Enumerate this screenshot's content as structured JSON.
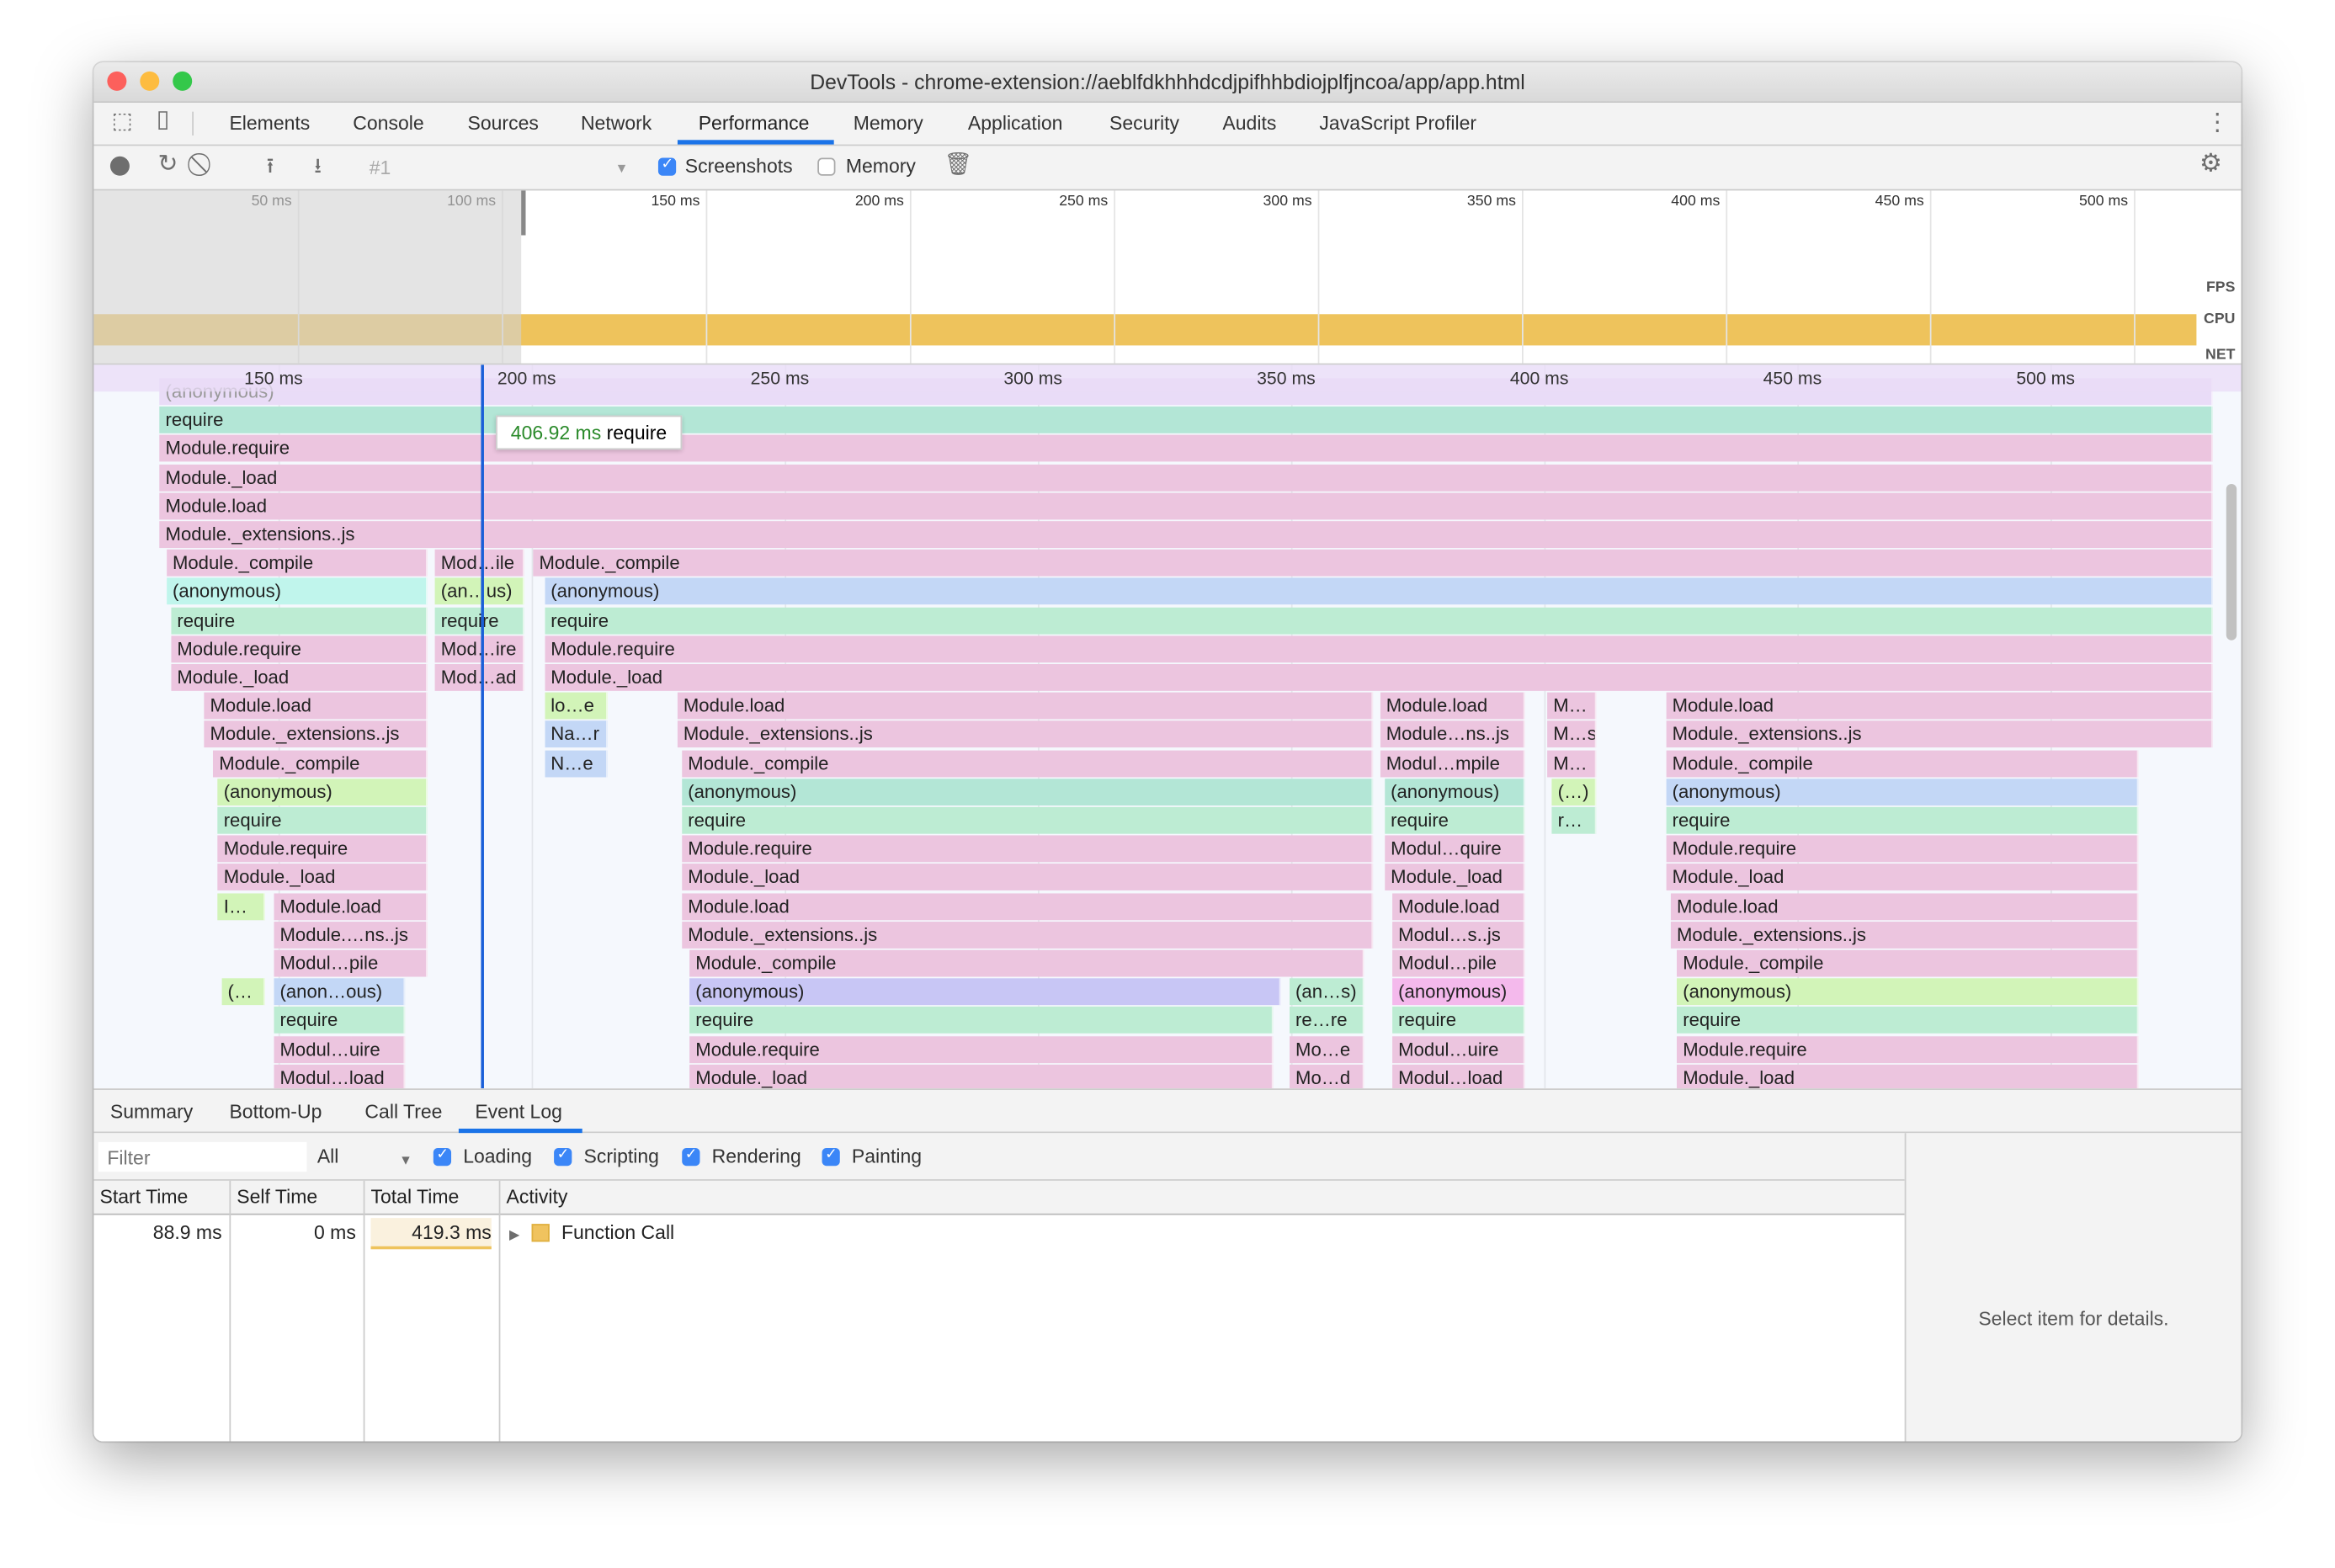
{
  "window": {
    "title": "DevTools - chrome-extension://aeblfdkhhhdcdjpifhhbdiojplfjncoa/app/app.html"
  },
  "tabs": [
    {
      "label": "Elements"
    },
    {
      "label": "Console"
    },
    {
      "label": "Sources"
    },
    {
      "label": "Network"
    },
    {
      "label": "Performance",
      "active": true
    },
    {
      "label": "Memory"
    },
    {
      "label": "Application"
    },
    {
      "label": "Security"
    },
    {
      "label": "Audits"
    },
    {
      "label": "JavaScript Profiler"
    }
  ],
  "toolbar": {
    "recording_select": "#1",
    "screenshots_label": "Screenshots",
    "screenshots_checked": true,
    "memory_label": "Memory",
    "memory_checked": false
  },
  "overview": {
    "ticks": [
      "50 ms",
      "100 ms",
      "150 ms",
      "200 ms",
      "250 ms",
      "300 ms",
      "350 ms",
      "400 ms",
      "450 ms",
      "500 ms"
    ],
    "tick_values": [
      50,
      100,
      150,
      200,
      250,
      300,
      350,
      400,
      450,
      500
    ],
    "selection_start_ms": 114,
    "lanes": [
      "FPS",
      "CPU",
      "NET"
    ],
    "cpu_color": "#eec35c"
  },
  "flame": {
    "ticks": [
      "150 ms",
      "200 ms",
      "250 ms",
      "300 ms",
      "350 ms",
      "400 ms",
      "450 ms",
      "500 ms"
    ],
    "tick_values": [
      150,
      200,
      250,
      300,
      350,
      400,
      450,
      500
    ],
    "cursor_ms": 190,
    "tooltip": {
      "time": "406.92 ms",
      "name": "require"
    },
    "colors": {
      "pink": "#ecc5df",
      "green": "#bdecd3",
      "teal": "#b3e6d6",
      "cyan": "#c0f5ec",
      "lgreen": "#d2f4b8",
      "blue": "#c3d7f6",
      "purple": "#c8c6f5",
      "magenta": "#f4b9ec",
      "faded": "#e9dcf7"
    },
    "rows": [
      [
        {
          "s": 126.5,
          "e": 532.1,
          "t": "(anonymous)",
          "c": "faded"
        }
      ],
      [
        {
          "s": 126.5,
          "e": 532.1,
          "t": "require",
          "c": "teal"
        }
      ],
      [
        {
          "s": 126.5,
          "e": 532.1,
          "t": "Module.require",
          "c": "pink"
        }
      ],
      [
        {
          "s": 126.5,
          "e": 532.1,
          "t": "Module._load",
          "c": "pink"
        }
      ],
      [
        {
          "s": 126.5,
          "e": 532.1,
          "t": "Module.load",
          "c": "pink"
        }
      ],
      [
        {
          "s": 126.5,
          "e": 532.1,
          "t": "Module._extensions..js",
          "c": "pink"
        }
      ],
      [
        {
          "s": 127.9,
          "e": 179.4,
          "t": "Module._compile",
          "c": "pink"
        },
        {
          "s": 180.9,
          "e": 198.5,
          "t": "Mod…ile",
          "c": "pink"
        },
        {
          "s": 200.3,
          "e": 532.1,
          "t": "Module._compile",
          "c": "pink"
        }
      ],
      [
        {
          "s": 127.9,
          "e": 179.4,
          "t": "(anonymous)",
          "c": "cyan"
        },
        {
          "s": 180.9,
          "e": 198.5,
          "t": "(an…us)",
          "c": "lgreen"
        },
        {
          "s": 202.6,
          "e": 532.1,
          "t": "(anonymous)",
          "c": "blue"
        }
      ],
      [
        {
          "s": 128.8,
          "e": 179.4,
          "t": "require",
          "c": "green"
        },
        {
          "s": 180.9,
          "e": 198.5,
          "t": "require",
          "c": "green"
        },
        {
          "s": 202.6,
          "e": 532.1,
          "t": "require",
          "c": "green"
        }
      ],
      [
        {
          "s": 128.8,
          "e": 179.4,
          "t": "Module.require",
          "c": "pink"
        },
        {
          "s": 180.9,
          "e": 198.5,
          "t": "Mod…ire",
          "c": "pink"
        },
        {
          "s": 202.6,
          "e": 532.1,
          "t": "Module.require",
          "c": "pink"
        }
      ],
      [
        {
          "s": 128.8,
          "e": 179.4,
          "t": "Module._load",
          "c": "pink"
        },
        {
          "s": 180.9,
          "e": 198.5,
          "t": "Mod…ad",
          "c": "pink"
        },
        {
          "s": 202.6,
          "e": 532.1,
          "t": "Module._load",
          "c": "pink"
        }
      ],
      [
        {
          "s": 135.3,
          "e": 179.4,
          "t": "Module.load",
          "c": "pink"
        },
        {
          "s": 202.6,
          "e": 215,
          "t": "lo…e",
          "c": "lgreen"
        },
        {
          "s": 228.8,
          "e": 366.2,
          "t": "Module.load",
          "c": "pink"
        },
        {
          "s": 367.6,
          "e": 396.2,
          "t": "Module.load",
          "c": "pink"
        },
        {
          "s": 400.6,
          "e": 410.3,
          "t": "M…",
          "c": "pink"
        },
        {
          "s": 424.1,
          "e": 532.1,
          "t": "Module.load",
          "c": "pink"
        }
      ],
      [
        {
          "s": 135.3,
          "e": 179.4,
          "t": "Module._extensions..js",
          "c": "pink"
        },
        {
          "s": 202.6,
          "e": 215,
          "t": "Na…r",
          "c": "blue"
        },
        {
          "s": 228.8,
          "e": 366.2,
          "t": "Module._extensions..js",
          "c": "pink"
        },
        {
          "s": 367.6,
          "e": 396.2,
          "t": "Module…ns..js",
          "c": "pink"
        },
        {
          "s": 400.6,
          "e": 410.3,
          "t": "M…s",
          "c": "pink"
        },
        {
          "s": 424.1,
          "e": 532.1,
          "t": "Module._extensions..js",
          "c": "pink"
        }
      ],
      [
        {
          "s": 137.1,
          "e": 179.4,
          "t": "Module._compile",
          "c": "pink"
        },
        {
          "s": 202.6,
          "e": 215,
          "t": "N…e",
          "c": "blue"
        },
        {
          "s": 229.7,
          "e": 366.2,
          "t": "Module._compile",
          "c": "pink"
        },
        {
          "s": 367.6,
          "e": 396.2,
          "t": "Modul…mpile",
          "c": "pink"
        },
        {
          "s": 400.6,
          "e": 410.3,
          "t": "M…",
          "c": "pink"
        },
        {
          "s": 424.1,
          "e": 517.4,
          "t": "Module._compile",
          "c": "pink"
        }
      ],
      [
        {
          "s": 138,
          "e": 179.4,
          "t": "(anonymous)",
          "c": "lgreen"
        },
        {
          "s": 229.7,
          "e": 366.2,
          "t": "(anonymous)",
          "c": "teal"
        },
        {
          "s": 368.5,
          "e": 396.2,
          "t": "(anonymous)",
          "c": "teal"
        },
        {
          "s": 401.5,
          "e": 410.3,
          "t": "(…)",
          "c": "lgreen"
        },
        {
          "s": 424.1,
          "e": 517.4,
          "t": "(anonymous)",
          "c": "blue"
        }
      ],
      [
        {
          "s": 138,
          "e": 179.4,
          "t": "require",
          "c": "green"
        },
        {
          "s": 229.7,
          "e": 366.2,
          "t": "require",
          "c": "green"
        },
        {
          "s": 368.5,
          "e": 396.2,
          "t": "require",
          "c": "green"
        },
        {
          "s": 401.5,
          "e": 410.3,
          "t": "r…",
          "c": "green"
        },
        {
          "s": 424.1,
          "e": 517.4,
          "t": "require",
          "c": "green"
        }
      ],
      [
        {
          "s": 138,
          "e": 179.4,
          "t": "Module.require",
          "c": "pink"
        },
        {
          "s": 229.7,
          "e": 366.2,
          "t": "Module.require",
          "c": "pink"
        },
        {
          "s": 368.5,
          "e": 396.2,
          "t": "Modul…quire",
          "c": "pink"
        },
        {
          "s": 424.1,
          "e": 517.4,
          "t": "Module.require",
          "c": "pink"
        }
      ],
      [
        {
          "s": 138,
          "e": 179.4,
          "t": "Module._load",
          "c": "pink"
        },
        {
          "s": 229.7,
          "e": 366.2,
          "t": "Module._load",
          "c": "pink"
        },
        {
          "s": 368.5,
          "e": 396.2,
          "t": "Module._load",
          "c": "pink"
        },
        {
          "s": 424.1,
          "e": 517.4,
          "t": "Module._load",
          "c": "pink"
        }
      ],
      [
        {
          "s": 138,
          "e": 147.4,
          "t": "I…",
          "c": "lgreen"
        },
        {
          "s": 149.1,
          "e": 179.4,
          "t": "Module.load",
          "c": "pink"
        },
        {
          "s": 229.7,
          "e": 366.2,
          "t": "Module.load",
          "c": "pink"
        },
        {
          "s": 370,
          "e": 396.2,
          "t": "Module.load",
          "c": "pink"
        },
        {
          "s": 425,
          "e": 517.4,
          "t": "Module.load",
          "c": "pink"
        }
      ],
      [
        {
          "s": 149.1,
          "e": 179.4,
          "t": "Module.…ns..js",
          "c": "pink"
        },
        {
          "s": 229.7,
          "e": 366.2,
          "t": "Module._extensions..js",
          "c": "pink"
        },
        {
          "s": 370,
          "e": 396.2,
          "t": "Modul…s..js",
          "c": "pink"
        },
        {
          "s": 425,
          "e": 517.4,
          "t": "Module._extensions..js",
          "c": "pink"
        }
      ],
      [
        {
          "s": 149.1,
          "e": 179.4,
          "t": "Modul…pile",
          "c": "pink"
        },
        {
          "s": 231.2,
          "e": 364.4,
          "t": "Module._compile",
          "c": "pink"
        },
        {
          "s": 370,
          "e": 396.2,
          "t": "Modul…pile",
          "c": "pink"
        },
        {
          "s": 426.2,
          "e": 517.4,
          "t": "Module._compile",
          "c": "pink"
        }
      ],
      [
        {
          "s": 138.8,
          "e": 147.4,
          "t": "(…",
          "c": "lgreen"
        },
        {
          "s": 149.1,
          "e": 175,
          "t": "(anon…ous)",
          "c": "blue"
        },
        {
          "s": 231.2,
          "e": 347.9,
          "t": "(anonymous)",
          "c": "purple"
        },
        {
          "s": 349.7,
          "e": 364.4,
          "t": "(an…s)",
          "c": "green"
        },
        {
          "s": 370,
          "e": 396.2,
          "t": "(anonymous)",
          "c": "magenta"
        },
        {
          "s": 426.2,
          "e": 517.4,
          "t": "(anonymous)",
          "c": "lgreen"
        }
      ],
      [
        {
          "s": 149.1,
          "e": 175,
          "t": "require",
          "c": "green"
        },
        {
          "s": 231.2,
          "e": 346.5,
          "t": "require",
          "c": "green"
        },
        {
          "s": 349.7,
          "e": 364.4,
          "t": "re…re",
          "c": "green"
        },
        {
          "s": 370,
          "e": 396.2,
          "t": "require",
          "c": "green"
        },
        {
          "s": 426.2,
          "e": 517.4,
          "t": "require",
          "c": "green"
        }
      ],
      [
        {
          "s": 149.1,
          "e": 175,
          "t": "Modul…uire",
          "c": "pink"
        },
        {
          "s": 231.2,
          "e": 346.5,
          "t": "Module.require",
          "c": "pink"
        },
        {
          "s": 349.7,
          "e": 364.4,
          "t": "Mo…e",
          "c": "pink"
        },
        {
          "s": 370,
          "e": 396.2,
          "t": "Modul…uire",
          "c": "pink"
        },
        {
          "s": 426.2,
          "e": 517.4,
          "t": "Module.require",
          "c": "pink"
        }
      ],
      [
        {
          "s": 149.1,
          "e": 175,
          "t": "Modul…load",
          "c": "pink"
        },
        {
          "s": 231.2,
          "e": 346.5,
          "t": "Module._load",
          "c": "pink"
        },
        {
          "s": 349.7,
          "e": 364.4,
          "t": "Mo…d",
          "c": "pink"
        },
        {
          "s": 370,
          "e": 396.2,
          "t": "Modul…load",
          "c": "pink"
        },
        {
          "s": 426.2,
          "e": 517.4,
          "t": "Module._load",
          "c": "pink"
        }
      ]
    ]
  },
  "bottom": {
    "tabs": [
      {
        "label": "Summary"
      },
      {
        "label": "Bottom-Up"
      },
      {
        "label": "Call Tree"
      },
      {
        "label": "Event Log",
        "active": true
      }
    ],
    "filter_placeholder": "Filter",
    "duration_select": "All",
    "categories": [
      {
        "label": "Loading",
        "checked": true
      },
      {
        "label": "Scripting",
        "checked": true
      },
      {
        "label": "Rendering",
        "checked": true
      },
      {
        "label": "Painting",
        "checked": true
      }
    ],
    "columns": [
      "Start Time",
      "Self Time",
      "Total Time",
      "Activity"
    ],
    "rows": [
      {
        "start": "88.9 ms",
        "self": "0 ms",
        "total": "419.3 ms",
        "activity": "Function Call",
        "color": "#f0c35f"
      }
    ],
    "details_placeholder": "Select item for details."
  }
}
